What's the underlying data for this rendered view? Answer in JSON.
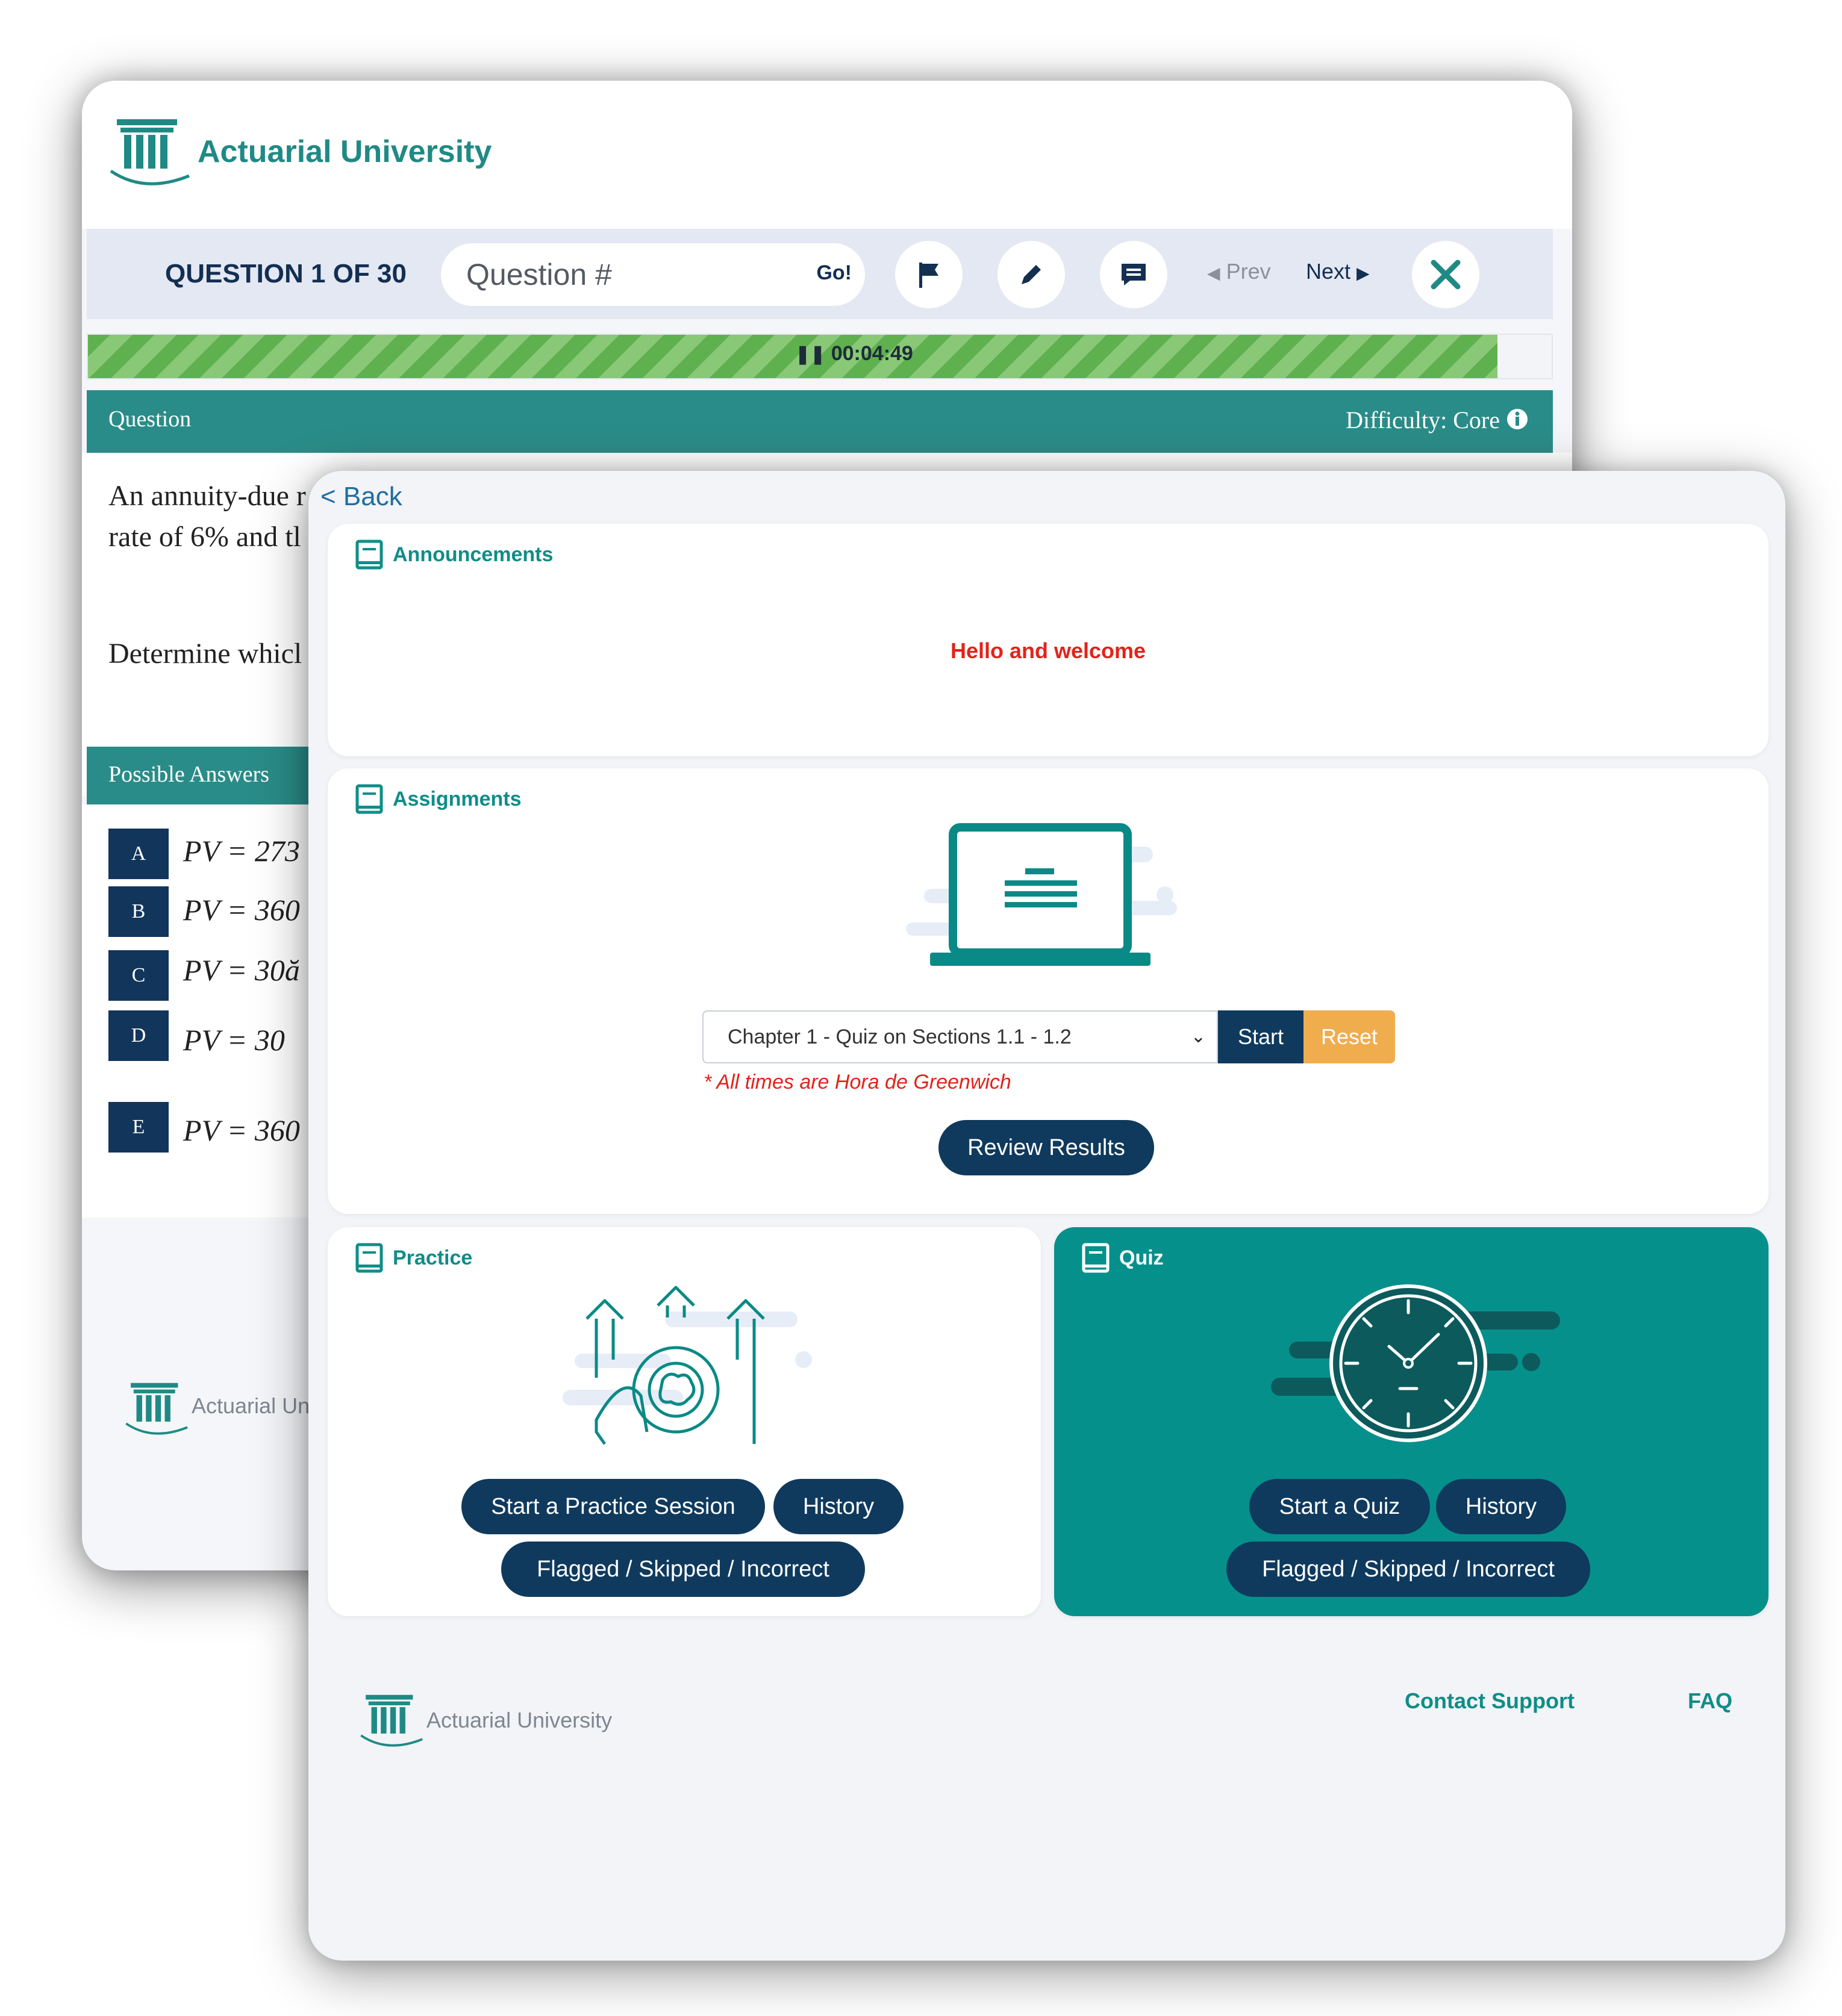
{
  "back_window": {
    "brand": "Actuarial University",
    "question_counter": "QUESTION 1 OF 30",
    "question_input_placeholder": "Question #",
    "go_label": "Go!",
    "prev_label": "Prev",
    "next_label": "Next",
    "timer": "00:04:49",
    "progress": 0.963,
    "question_header": "Question",
    "difficulty": "Difficulty: Core",
    "question_lines": [
      "An annuity-due r",
      "rate of 6% and tl",
      "Determine whicl"
    ],
    "answers_header": "Possible Answers",
    "answers": [
      {
        "letter": "A",
        "text": "PV = 273"
      },
      {
        "letter": "B",
        "text": "PV = 360"
      },
      {
        "letter": "C",
        "text": "PV = 30ă"
      },
      {
        "letter": "D",
        "text": "PV = 30"
      },
      {
        "letter": "E",
        "text": "PV = 360"
      }
    ],
    "footer_brand": "Actuarial Un"
  },
  "front_window": {
    "back_label": "< Back",
    "announcements": {
      "title": "Announcements",
      "message": "Hello and welcome"
    },
    "assignments": {
      "title": "Assignments",
      "selected_quiz": "Chapter 1 - Quiz on Sections 1.1 - 1.2",
      "start_label": "Start",
      "reset_label": "Reset",
      "timezone_note": "* All times are Hora de Greenwich",
      "review_label": "Review Results"
    },
    "practice": {
      "title": "Practice",
      "start_label": "Start a Practice Session",
      "history_label": "History",
      "flagged_label": "Flagged / Skipped / Incorrect"
    },
    "quiz": {
      "title": "Quiz",
      "start_label": "Start a Quiz",
      "history_label": "History",
      "flagged_label": "Flagged / Skipped / Incorrect"
    },
    "footer": {
      "brand": "Actuarial University",
      "contact_label": "Contact Support",
      "faq_label": "FAQ"
    }
  },
  "colors": {
    "teal": "#1f8a85",
    "navy": "#0f3a5d",
    "orange": "#f0ad4e",
    "red": "#e2231a",
    "quiz_card": "#06908b"
  }
}
